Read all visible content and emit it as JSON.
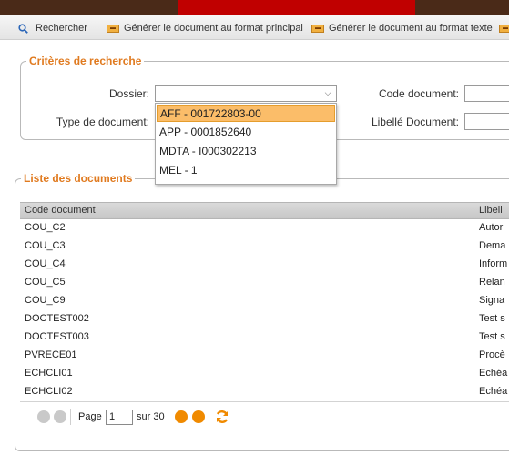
{
  "toolbar": {
    "search_label": "Rechercher",
    "gen_main_label": "Générer le document au format principal",
    "gen_text_label": "Générer le document au format texte"
  },
  "criteria": {
    "legend": "Critères de recherche",
    "dossier_label": "Dossier:",
    "type_label": "Type de document:",
    "code_label": "Code document:",
    "libelle_label": "Libellé Document:"
  },
  "dropdown": {
    "options": [
      "AFF - 001722803-00",
      "APP - 0001852640",
      "MDTA - I000302213",
      "MEL - 1"
    ],
    "selected_index": 0
  },
  "list": {
    "legend": "Liste des documents",
    "columns": [
      "Code document",
      "Libell"
    ],
    "rows": [
      {
        "code": "COU_C2",
        "libelle": "Autor"
      },
      {
        "code": "COU_C3",
        "libelle": "Dema"
      },
      {
        "code": "COU_C4",
        "libelle": "Inform"
      },
      {
        "code": "COU_C5",
        "libelle": "Relan"
      },
      {
        "code": "COU_C9",
        "libelle": "Signa"
      },
      {
        "code": "DOCTEST002",
        "libelle": "Test s"
      },
      {
        "code": "DOCTEST003",
        "libelle": "Test s"
      },
      {
        "code": "PVRECE01",
        "libelle": "Procè"
      },
      {
        "code": "ECHCLI01",
        "libelle": "Echéa"
      },
      {
        "code": "ECHCLI02",
        "libelle": "Echéa"
      }
    ]
  },
  "pager": {
    "page_label": "Page",
    "page_value": "1",
    "of_label": "sur 30"
  },
  "colors": {
    "accent": "#e07a1f",
    "selected": "#fbbd69",
    "top_red": "#c00000",
    "top_brown": "#4a2a18"
  }
}
